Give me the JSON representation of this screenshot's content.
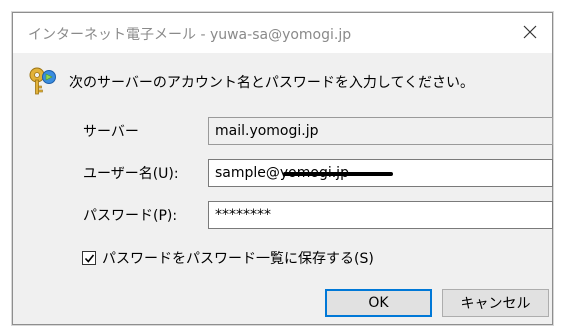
{
  "window": {
    "title": "インターネット電子メール - yuwa-sa@yomogi.jp",
    "close_icon": "close-icon"
  },
  "prompt": {
    "icon": "keys-icon",
    "text": "次のサーバーのアカウント名とパスワードを入力してください。"
  },
  "fields": {
    "server_label": "サーバー",
    "server_value": "mail.yomogi.jp",
    "username_label": "ユーザー名(U):",
    "username_value": "sample@yomogi.jp",
    "password_label": "パスワード(P):",
    "password_value": "********"
  },
  "save_password": {
    "checked": true,
    "label": "パスワードをパスワード一覧に保存する(S)"
  },
  "buttons": {
    "ok": "OK",
    "cancel": "キャンセル"
  },
  "colors": {
    "accent": "#0078d7",
    "dialog_bg": "#f0f0f0"
  }
}
